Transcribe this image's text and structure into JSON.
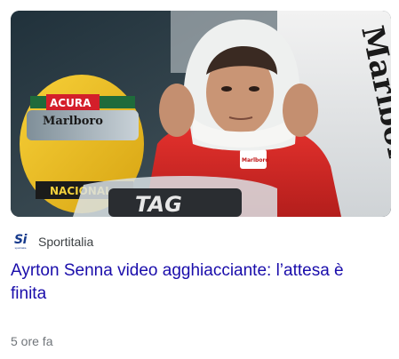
{
  "article": {
    "image_alt": "Ayrton Senna nella monoposto McLaren con il casco",
    "image_texts": {
      "helmet_brand": "ACURA",
      "helmet_sponsor": "Marlboro",
      "helmet_visor": "NACIONAL",
      "bodywork": "Marlboro",
      "steering": "TAG",
      "suit_badge": "Marlboro"
    },
    "source": {
      "logo_text": "Si",
      "logo_sub": "sportitalia",
      "name": "Sportitalia"
    },
    "headline": "Ayrton Senna video agghiacciante: l’attesa è finita",
    "time": "5 ore fa"
  },
  "colors": {
    "headline": "#1a0dab",
    "source_logo": "#163a8c",
    "meta_text": "#70757a"
  }
}
